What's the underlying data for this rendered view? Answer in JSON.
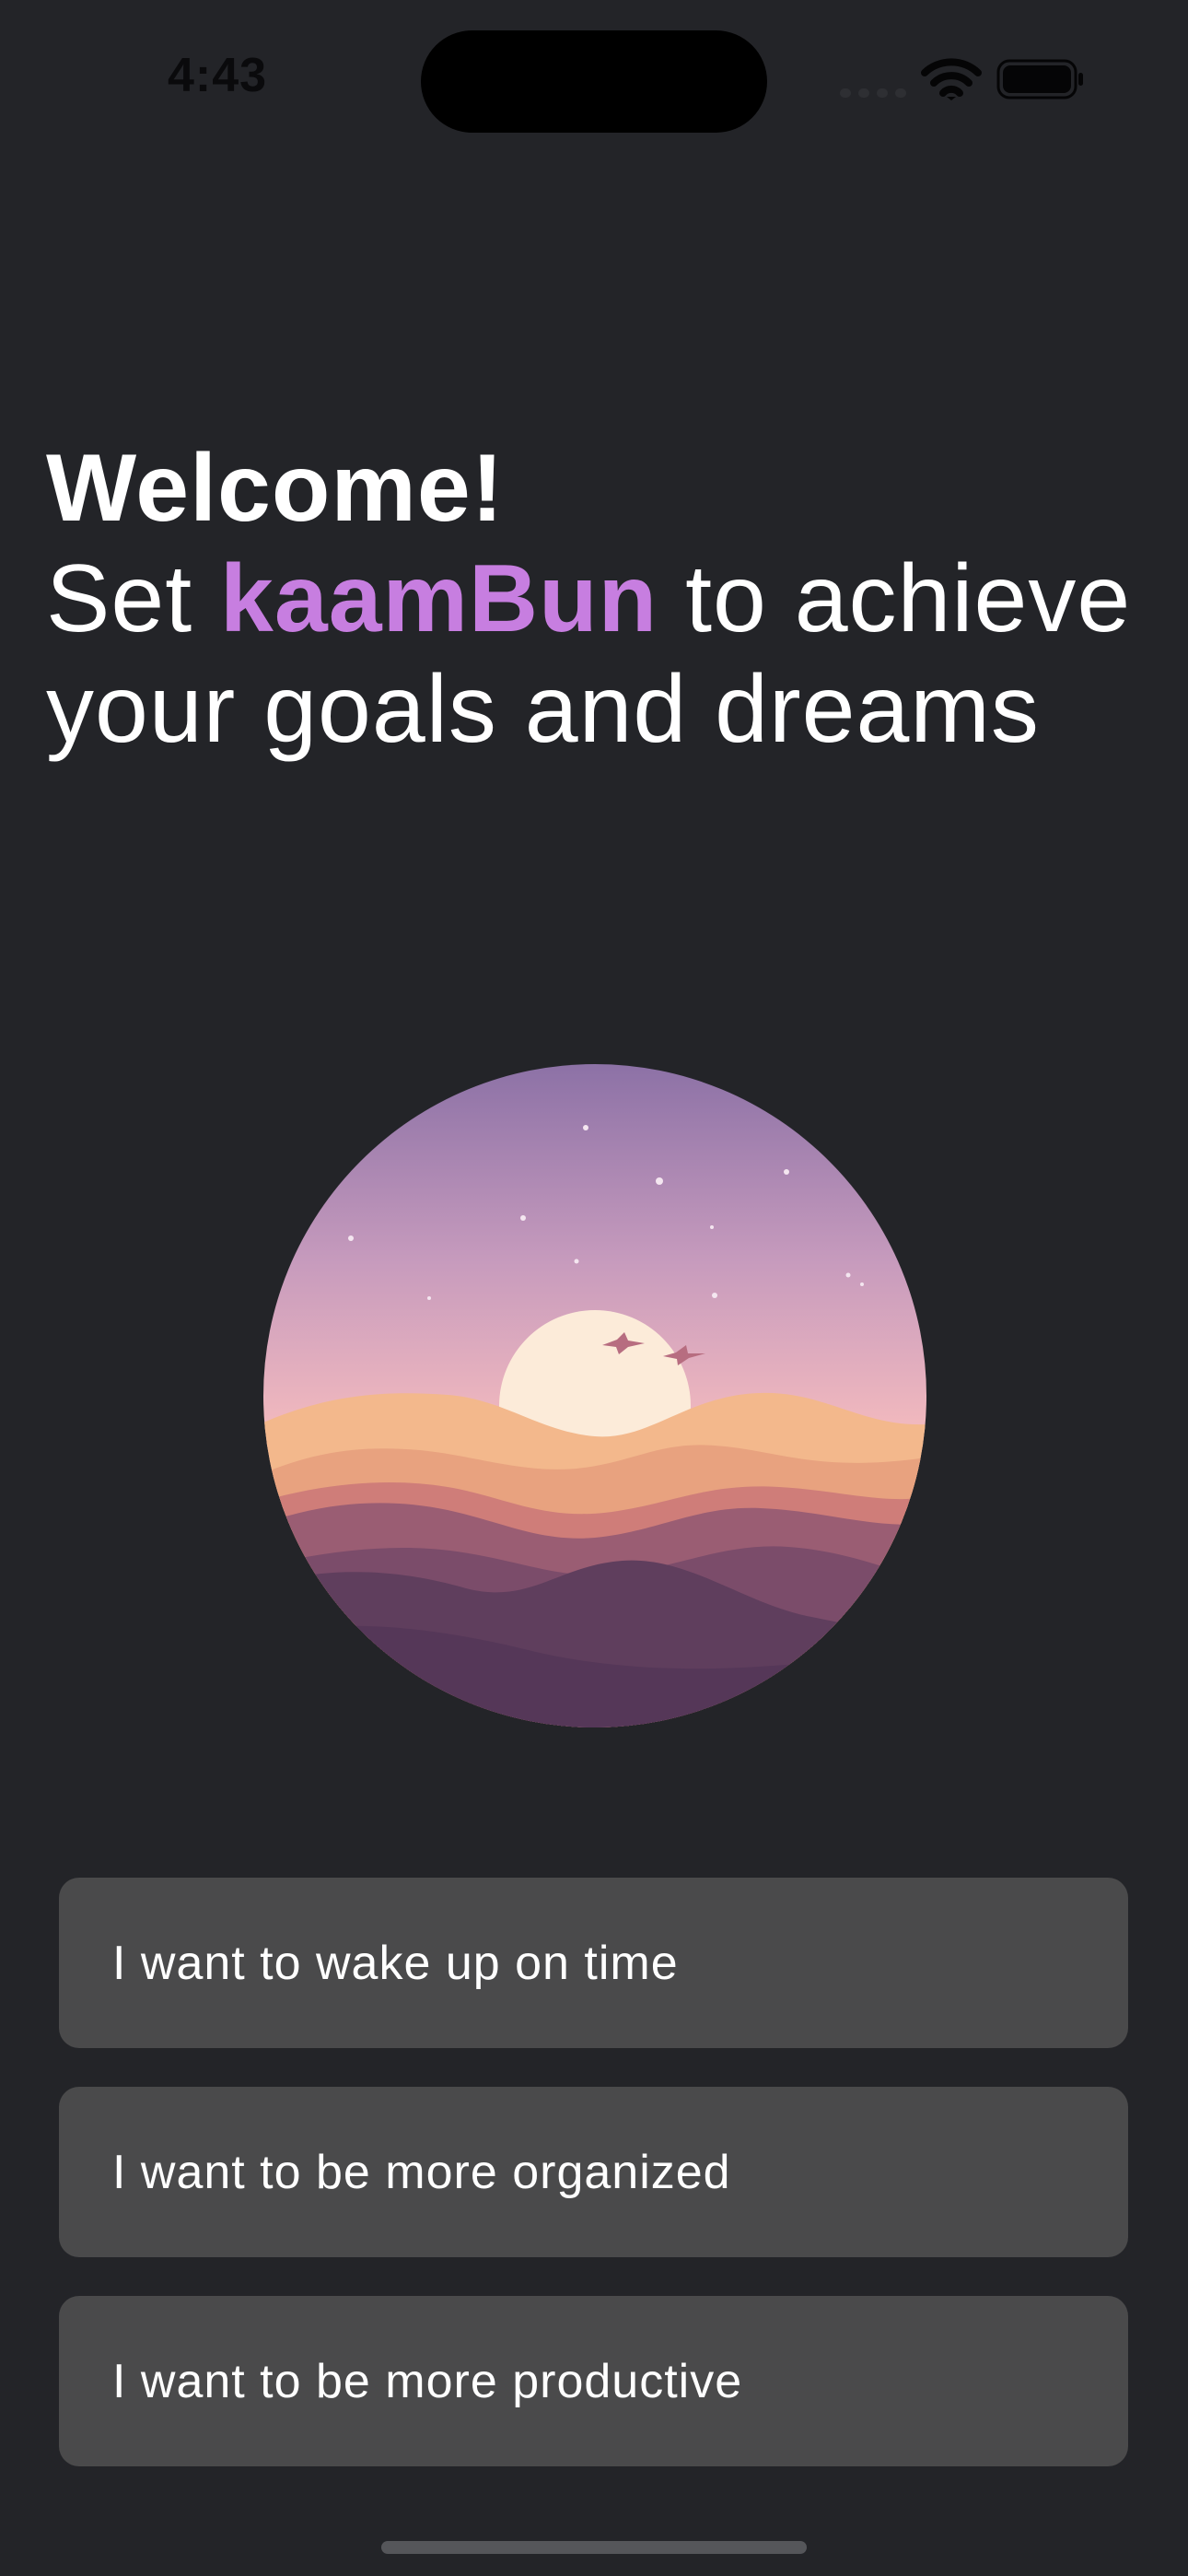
{
  "status_bar": {
    "time": "4:43",
    "icons": [
      "signal-icon",
      "wifi-icon",
      "battery-icon"
    ]
  },
  "heading": {
    "welcome": "Welcome!",
    "line_prefix": "Set",
    "brand": "kaamBun",
    "line_suffix": "to achieve your goals and dreams"
  },
  "illustration": {
    "subject": "sunset-mountains-illustration"
  },
  "options": [
    {
      "label": "I want to wake up on time"
    },
    {
      "label": "I want to be more organized"
    },
    {
      "label": "I want to be more productive"
    }
  ],
  "colors": {
    "background": "#232428",
    "brand_accent": "#c77ee0",
    "option_background": "#4a4a4b",
    "text": "#ffffff"
  }
}
